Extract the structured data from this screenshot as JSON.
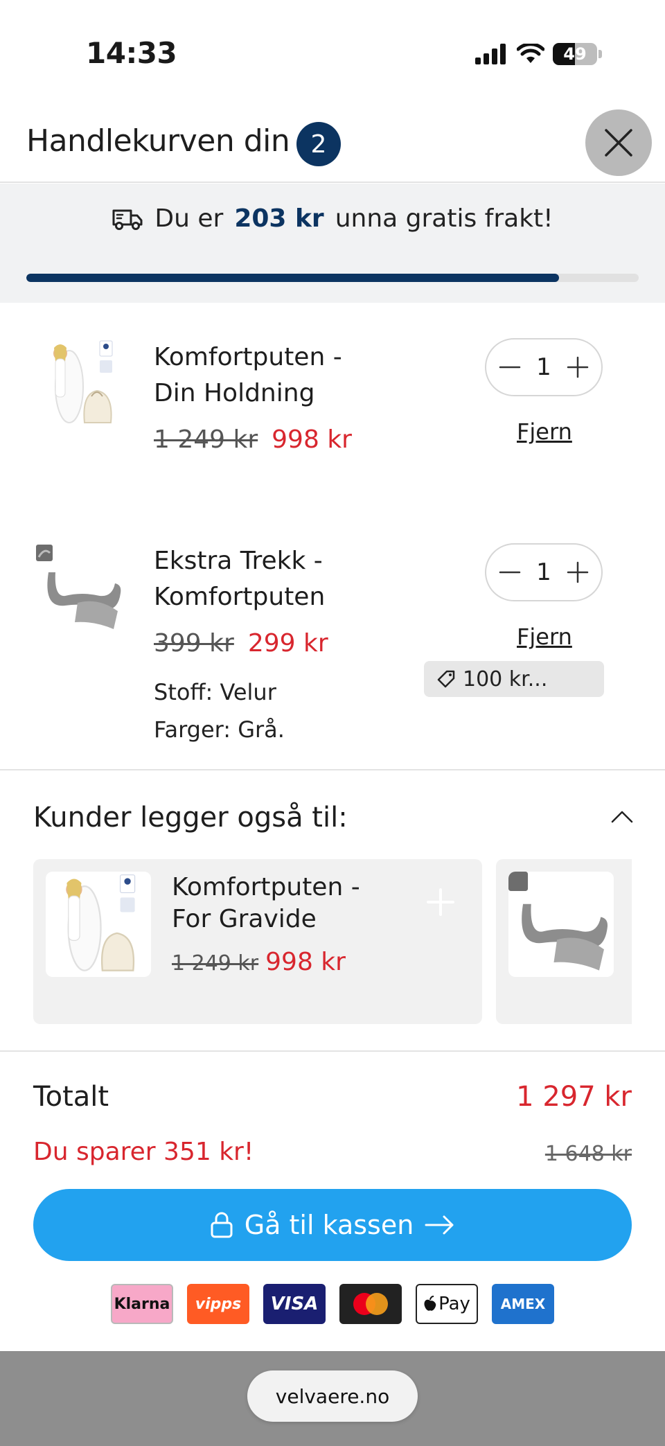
{
  "status_bar": {
    "time": "14:33",
    "battery": "49"
  },
  "header": {
    "title": "Handlekurven din",
    "item_count": "2"
  },
  "shipping": {
    "prefix": "Du er",
    "amount": "203 kr",
    "suffix": "unna gratis frakt!",
    "progress": 0.87,
    "bar_color": "#0c3461"
  },
  "items": [
    {
      "name": "Komfortputen - Din Holdning",
      "old_price": "1 249 kr",
      "new_price": "998 kr",
      "quantity": "1",
      "remove_label": "Fjern"
    },
    {
      "name": "Ekstra Trekk - Komfortputen",
      "old_price": "399 kr",
      "new_price": "299 kr",
      "quantity": "1",
      "remove_label": "Fjern",
      "discount": "100 kr...",
      "variants": [
        "Stoff: Velur",
        "Farger: Grå."
      ]
    }
  ],
  "recommendations": {
    "title": "Kunder legger også til:",
    "products": [
      {
        "name": "Komfortputen - For Gravide",
        "old_price": "1 249 kr",
        "new_price": "998 kr"
      }
    ]
  },
  "totals": {
    "label": "Totalt",
    "value": "1 297 kr",
    "savings": "Du sparer 351 kr!",
    "original": "1 648 kr"
  },
  "checkout": {
    "label": "Gå til kassen",
    "color": "#22a2ef"
  },
  "payment_methods": [
    "Klarna",
    "vipps",
    "VISA",
    "Mastercard",
    "Pay",
    "AMEX"
  ],
  "browser": {
    "url": "velvaere.no"
  },
  "colors": {
    "accent": "#0c3461",
    "sale": "#d8262e",
    "button": "#22a2ef"
  }
}
